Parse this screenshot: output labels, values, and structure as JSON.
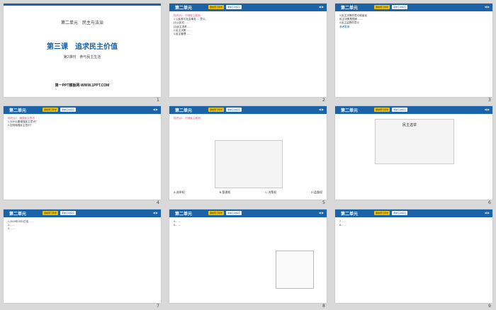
{
  "slides": [
    {
      "unit_label": "第二单元　民主与法治",
      "lesson_title": "第三课　追求民主价值",
      "subtitle": "第2课时　参与民主生活",
      "footer": "第一PPT模板网-WWW.1PPT.COM",
      "number": "1"
    },
    {
      "header": "第二单元",
      "tab1": "课前预习导学",
      "tab2": "课堂互动探究",
      "section": "知识点1　行使民主权利",
      "lines": [
        "1.公民参与社会事务 … 意义。",
        "(1)公民在……",
        "(2)民主选举……",
        "2.民主决策……",
        "3.民主管理……"
      ],
      "number": "2"
    },
    {
      "header": "第二单元",
      "tab1": "课前预习导学",
      "tab2": "课堂互动探究",
      "lines": [
        "3.民主决策的意义和途径",
        "民主决策是国家 ……",
        "4.民主监督的意义"
      ],
      "highlight": "参考答案",
      "number": "3"
    },
    {
      "header": "第二单元",
      "tab1": "课前预习导学",
      "tab2": "课堂互动探究",
      "section": "知识点2　增强民主意识",
      "lines": [
        "1.为什么要增强民主意识？",
        "2.如何增强民主意识？"
      ],
      "number": "4"
    },
    {
      "header": "第二单元",
      "tab1": "课前预习导学",
      "tab2": "课堂互动探究",
      "section": "知识点1　行使民主权利",
      "options": [
        "A.选举权",
        "B.管理权",
        "C.决策权",
        "D.监督权"
      ],
      "number": "5"
    },
    {
      "header": "第二单元",
      "tab1": "课前预习导学",
      "tab2": "课堂互动探究",
      "caption": "民主选举",
      "number": "6"
    },
    {
      "header": "第二单元",
      "tab1": "课前预习导学",
      "tab2": "课堂互动探究",
      "lines": [
        "1.2019年3月1日至……",
        "2.……",
        "3.……"
      ],
      "number": "7"
    },
    {
      "header": "第二单元",
      "tab1": "课前预习导学",
      "tab2": "课堂互动探究",
      "lines": [
        "4.……",
        "5.……"
      ],
      "number": "8"
    },
    {
      "header": "第二单元",
      "tab1": "课前预习导学",
      "tab2": "课堂互动探究",
      "lines": [
        "7.……",
        "8.……"
      ],
      "number": "9"
    }
  ]
}
